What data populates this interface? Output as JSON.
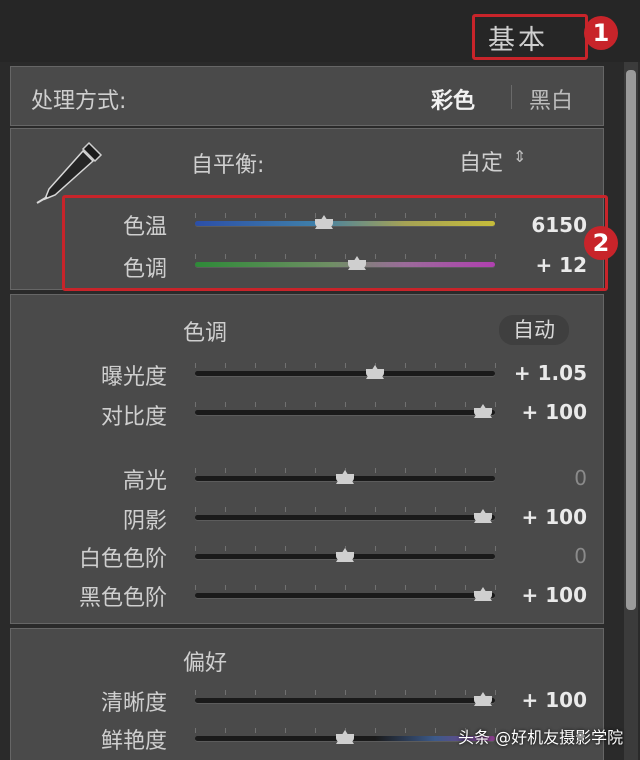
{
  "panel": {
    "title": "基本"
  },
  "annotations": {
    "badge1": "1",
    "badge2": "2",
    "color_red": "#c8242a"
  },
  "treatment": {
    "label": "处理方式:",
    "options": [
      "彩色",
      "黑白"
    ],
    "selected": "彩色"
  },
  "white_balance": {
    "label": "自平衡:",
    "preset": "自定",
    "preset_arrow": "⇕",
    "sliders": [
      {
        "label": "色温",
        "value_text": "6150",
        "position": 0.43
      },
      {
        "label": "色调",
        "value_text": "+ 12",
        "position": 0.54
      }
    ]
  },
  "tone": {
    "heading": "色调",
    "auto_label": "自动",
    "sliders": [
      {
        "label": "曝光度",
        "value_text": "+ 1.05",
        "position": 0.6
      },
      {
        "label": "对比度",
        "value_text": "+ 100",
        "position": 0.96
      },
      {
        "label": "高光",
        "value_text": "0",
        "position": 0.5
      },
      {
        "label": "阴影",
        "value_text": "+ 100",
        "position": 0.96
      },
      {
        "label": "白色色阶",
        "value_text": "0",
        "position": 0.5
      },
      {
        "label": "黑色色阶",
        "value_text": "+ 100",
        "position": 0.96
      }
    ]
  },
  "presence": {
    "heading": "偏好",
    "sliders": [
      {
        "label": "清晰度",
        "value_text": "+ 100",
        "position": 0.96
      },
      {
        "label": "鲜艳度",
        "value_text": "",
        "position": 0.5
      }
    ]
  },
  "watermark": "头条 @好机友摄影学院"
}
